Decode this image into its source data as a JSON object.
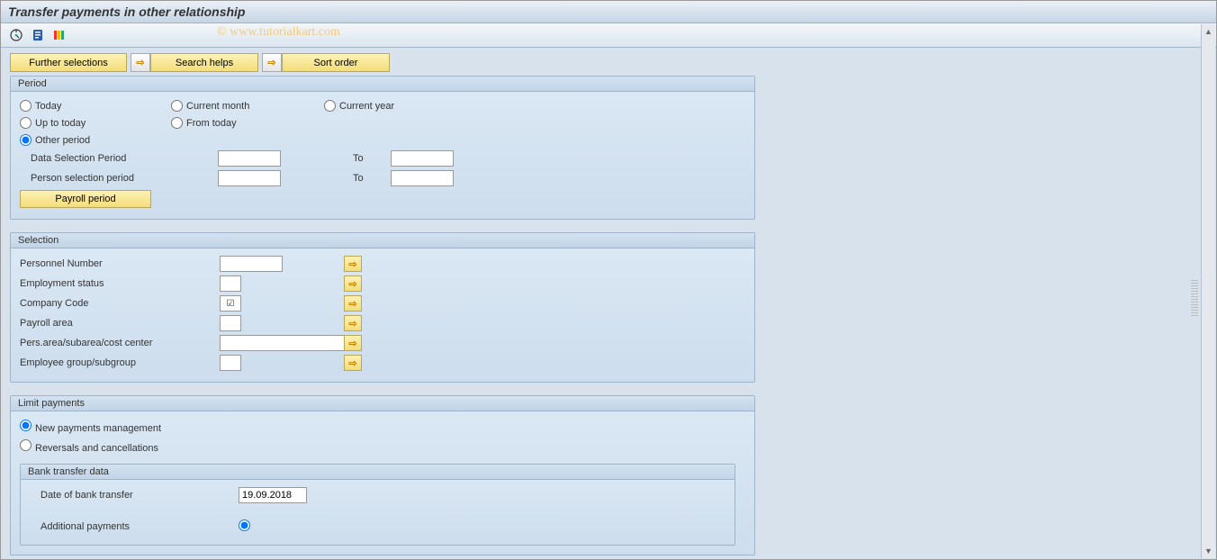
{
  "title": "Transfer payments in other relationship",
  "watermark": "© www.tutorialkart.com",
  "toolbar": {
    "icons": [
      "execute-icon",
      "info-icon",
      "variant-icon"
    ]
  },
  "actions": {
    "further_selections": "Further selections",
    "search_helps": "Search helps",
    "sort_order": "Sort order"
  },
  "period": {
    "legend": "Period",
    "today": "Today",
    "current_month": "Current month",
    "current_year": "Current year",
    "up_to_today": "Up to today",
    "from_today": "From today",
    "other_period": "Other period",
    "data_selection_period": "Data Selection Period",
    "person_selection_period": "Person selection period",
    "to": "To",
    "payroll_period_btn": "Payroll period",
    "data_sel_from": "",
    "data_sel_to": "",
    "person_sel_from": "",
    "person_sel_to": "",
    "selected": "other_period"
  },
  "selection": {
    "legend": "Selection",
    "rows": [
      {
        "label": "Personnel Number",
        "value": "",
        "width": "w60"
      },
      {
        "label": "Employment status",
        "value": "",
        "width": "w30"
      },
      {
        "label": "Company Code",
        "value": "",
        "width": "w30",
        "checked": true
      },
      {
        "label": "Payroll area",
        "value": "",
        "width": "w30"
      },
      {
        "label": "Pers.area/subarea/cost center",
        "value": "",
        "width": "w130"
      },
      {
        "label": "Employee group/subgroup",
        "value": "",
        "width": "w30"
      }
    ]
  },
  "limit": {
    "legend": "Limit payments",
    "new_payments": "New payments management",
    "reversals": "Reversals and cancellations",
    "selected": "new_payments",
    "bank": {
      "legend": "Bank transfer data",
      "date_label": "Date of bank transfer",
      "date_value": "19.09.2018",
      "additional_label": "Additional payments"
    }
  }
}
